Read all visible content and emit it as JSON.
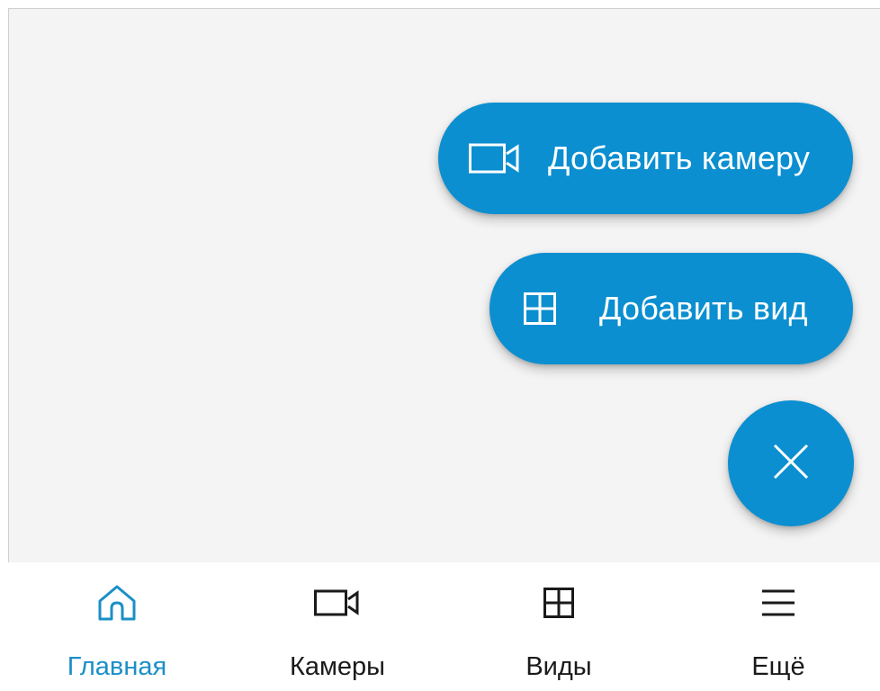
{
  "fab_menu": {
    "add_camera_label": "Добавить камеру",
    "add_view_label": "Добавить вид",
    "close_icon": "close-icon"
  },
  "bottom_nav": {
    "items": [
      {
        "label": "Главная",
        "icon": "home-icon",
        "active": true
      },
      {
        "label": "Камеры",
        "icon": "video-camera-icon",
        "active": false
      },
      {
        "label": "Виды",
        "icon": "grid-icon",
        "active": false
      },
      {
        "label": "Ещё",
        "icon": "menu-icon",
        "active": false
      }
    ]
  },
  "colors": {
    "accent": "#0b8fd0",
    "active_nav": "#1b8fc6",
    "content_background": "#f4f4f4"
  }
}
